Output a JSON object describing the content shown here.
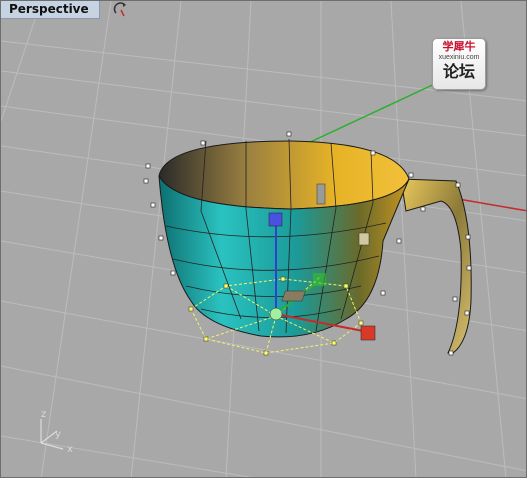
{
  "viewport": {
    "title": "Perspective",
    "rotate_icon": "rotate-view-icon"
  },
  "watermark": {
    "line1": "学犀牛",
    "line2": "xuexiniu.com",
    "line3": "论坛"
  },
  "axis_widget": {
    "z_label": "z",
    "y_label": "y",
    "x_label": "x"
  },
  "colors": {
    "background": "#a8a8a8",
    "grid": "#b9b9b9",
    "cup_outer": "#1fa6a6",
    "cup_inner": "#e0a820",
    "x_axis": "#c83030",
    "y_axis": "#30a030",
    "z_axis": "#3040d0",
    "control_points": "#ffff66"
  },
  "icons": [
    "rotate-view-icon"
  ]
}
